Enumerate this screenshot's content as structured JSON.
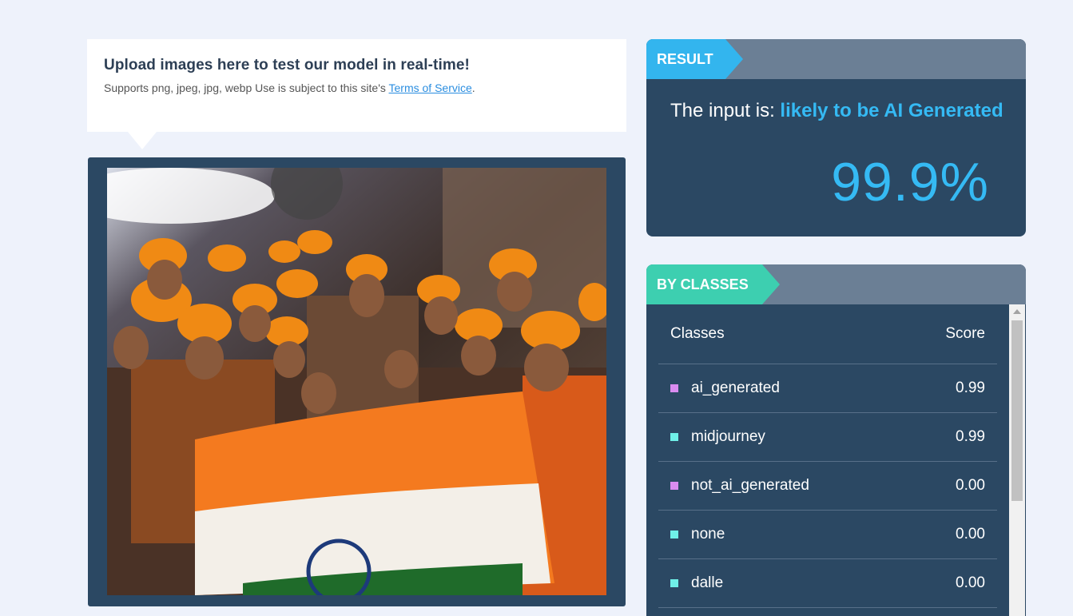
{
  "upload": {
    "title": "Upload images here to test our model in real-time!",
    "subtitle_prefix": "Supports png, jpeg, jpg, webp Use is subject to this site's ",
    "terms_link": "Terms of Service",
    "subtitle_suffix": "."
  },
  "image": {
    "alt": "uploaded photo of workers in orange hard hats holding an Indian flag in a tunnel"
  },
  "result": {
    "tag": "RESULT",
    "prefix": "The input is: ",
    "verdict": "likely to be AI Generated",
    "percent": "99.9%"
  },
  "classes": {
    "tag": "BY CLASSES",
    "header_class": "Classes",
    "header_score": "Score",
    "rows": [
      {
        "name": "ai_generated",
        "score": "0.99",
        "color": "#d98cf0"
      },
      {
        "name": "midjourney",
        "score": "0.99",
        "color": "#6ff0e8"
      },
      {
        "name": "not_ai_generated",
        "score": "0.00",
        "color": "#d98cf0"
      },
      {
        "name": "none",
        "score": "0.00",
        "color": "#6ff0e8"
      },
      {
        "name": "dalle",
        "score": "0.00",
        "color": "#6ff0e8"
      }
    ]
  },
  "colors": {
    "accent_blue": "#35baf4",
    "accent_green": "#3dcfb0",
    "panel": "#2b4863"
  }
}
